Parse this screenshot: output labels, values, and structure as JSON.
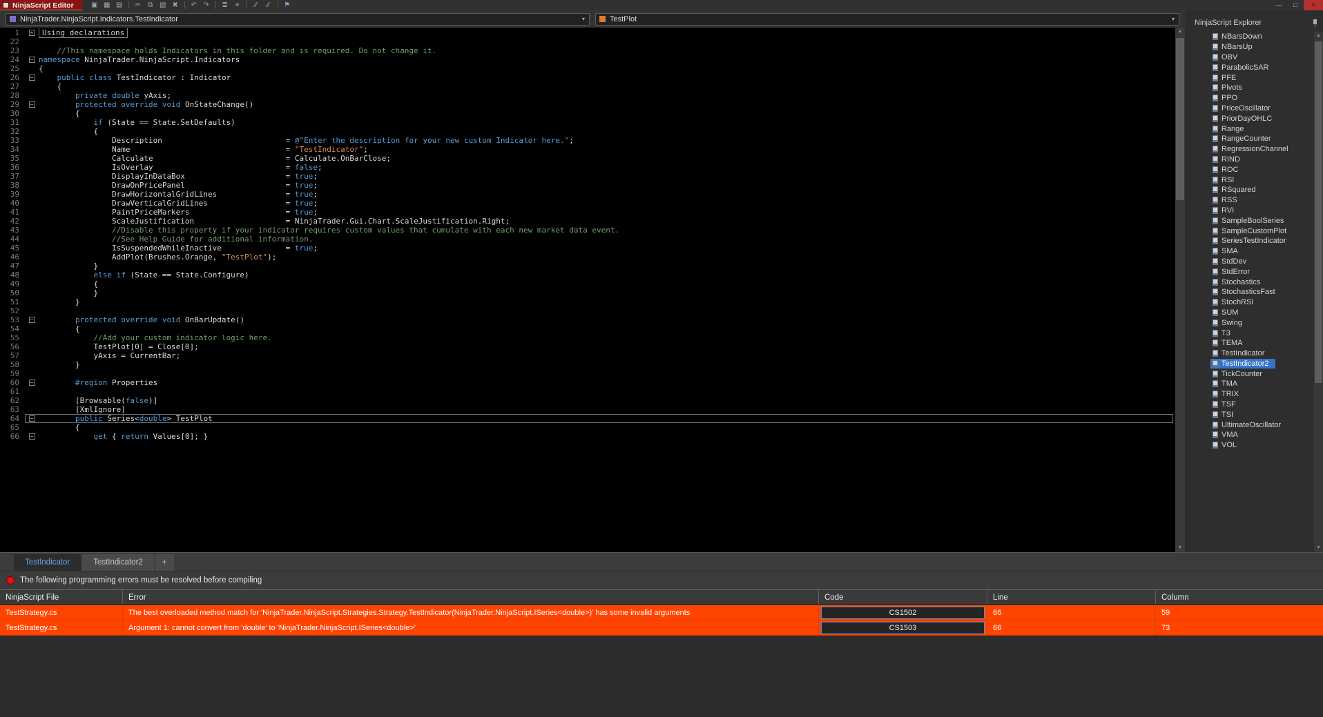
{
  "window": {
    "title": "NinjaScript Editor",
    "controls": {
      "minimize": "—",
      "maximize": "□",
      "close": "×"
    }
  },
  "toolbar": {
    "icons": [
      {
        "name": "save-icon",
        "glyph": "▣"
      },
      {
        "name": "save-all-icon",
        "glyph": "▦"
      },
      {
        "name": "print-icon",
        "glyph": "▤"
      },
      {
        "name": "separator"
      },
      {
        "name": "cut-icon",
        "glyph": "✂"
      },
      {
        "name": "copy-icon",
        "glyph": "⧉"
      },
      {
        "name": "paste-icon",
        "glyph": "▧"
      },
      {
        "name": "delete-icon",
        "glyph": "✖"
      },
      {
        "name": "separator"
      },
      {
        "name": "undo-icon",
        "glyph": "↶"
      },
      {
        "name": "redo-icon",
        "glyph": "↷"
      },
      {
        "name": "separator"
      },
      {
        "name": "format-document-icon",
        "glyph": "≣"
      },
      {
        "name": "indent-icon",
        "glyph": "≡"
      },
      {
        "name": "separator"
      },
      {
        "name": "comment-selection-icon",
        "glyph": "∕∕"
      },
      {
        "name": "uncomment-selection-icon",
        "glyph": "∕∕"
      },
      {
        "name": "separator"
      },
      {
        "name": "compile-icon",
        "glyph": "⚑",
        "accent": true
      }
    ]
  },
  "combos": {
    "type": {
      "value": "NinjaTrader.NinjaScript.Indicators.TestIndicator"
    },
    "member": {
      "value": "TestPlot"
    }
  },
  "icons": {
    "chevron": "▾",
    "scroll_up": "▲",
    "scroll_down": "▼"
  },
  "editor": {
    "lines": [
      {
        "n": 1,
        "fold": "+",
        "box": "Using declarations"
      },
      {
        "n": 22,
        "seg": []
      },
      {
        "n": 23,
        "seg": [
          [
            "c",
            "    //This namespace holds Indicators in this folder and is required. Do not change it."
          ]
        ]
      },
      {
        "n": 24,
        "fold": "-",
        "seg": [
          [
            "k",
            "namespace"
          ],
          [
            "p",
            " NinjaTrader.NinjaScript.Indicators"
          ]
        ]
      },
      {
        "n": 25,
        "seg": [
          [
            "p",
            "{"
          ]
        ]
      },
      {
        "n": 26,
        "fold": "-",
        "seg": [
          [
            "p",
            "    "
          ],
          [
            "k",
            "public"
          ],
          [
            "p",
            " "
          ],
          [
            "k",
            "class"
          ],
          [
            "p",
            " TestIndicator : Indicator"
          ]
        ]
      },
      {
        "n": 27,
        "seg": [
          [
            "p",
            "    {"
          ]
        ]
      },
      {
        "n": 28,
        "seg": [
          [
            "p",
            "        "
          ],
          [
            "k",
            "private"
          ],
          [
            "p",
            " "
          ],
          [
            "k",
            "double"
          ],
          [
            "p",
            " yAxis;"
          ]
        ]
      },
      {
        "n": 29,
        "fold": "-",
        "seg": [
          [
            "p",
            "        "
          ],
          [
            "k",
            "protected"
          ],
          [
            "p",
            " "
          ],
          [
            "k",
            "override"
          ],
          [
            "p",
            " "
          ],
          [
            "k",
            "void"
          ],
          [
            "p",
            " OnStateChange()"
          ]
        ]
      },
      {
        "n": 30,
        "seg": [
          [
            "p",
            "        {"
          ]
        ]
      },
      {
        "n": 31,
        "seg": [
          [
            "p",
            "            "
          ],
          [
            "k",
            "if"
          ],
          [
            "p",
            " (State == State.SetDefaults)"
          ]
        ]
      },
      {
        "n": 32,
        "seg": [
          [
            "p",
            "            {"
          ]
        ]
      },
      {
        "n": 33,
        "seg": [
          [
            "p",
            "                "
          ],
          [
            "f",
            "Description"
          ],
          [
            "p",
            "= "
          ],
          [
            "v",
            "@\"Enter the description for your new custom Indicator here.\""
          ],
          [
            "p",
            ";"
          ]
        ]
      },
      {
        "n": 34,
        "seg": [
          [
            "p",
            "                "
          ],
          [
            "f",
            "Name"
          ],
          [
            "p",
            "= "
          ],
          [
            "s",
            "\"TestIndicator\""
          ],
          [
            "p",
            ";"
          ]
        ]
      },
      {
        "n": 35,
        "seg": [
          [
            "p",
            "                "
          ],
          [
            "f",
            "Calculate"
          ],
          [
            "p",
            "= Calculate.OnBarClose;"
          ]
        ]
      },
      {
        "n": 36,
        "seg": [
          [
            "p",
            "                "
          ],
          [
            "f",
            "IsOverlay"
          ],
          [
            "p",
            "= "
          ],
          [
            "k",
            "false"
          ],
          [
            "p",
            ";"
          ]
        ]
      },
      {
        "n": 37,
        "seg": [
          [
            "p",
            "                "
          ],
          [
            "f",
            "DisplayInDataBox"
          ],
          [
            "p",
            "= "
          ],
          [
            "k",
            "true"
          ],
          [
            "p",
            ";"
          ]
        ]
      },
      {
        "n": 38,
        "seg": [
          [
            "p",
            "                "
          ],
          [
            "f",
            "DrawOnPricePanel"
          ],
          [
            "p",
            "= "
          ],
          [
            "k",
            "true"
          ],
          [
            "p",
            ";"
          ]
        ]
      },
      {
        "n": 39,
        "seg": [
          [
            "p",
            "                "
          ],
          [
            "f",
            "DrawHorizontalGridLines"
          ],
          [
            "p",
            "= "
          ],
          [
            "k",
            "true"
          ],
          [
            "p",
            ";"
          ]
        ]
      },
      {
        "n": 40,
        "seg": [
          [
            "p",
            "                "
          ],
          [
            "f",
            "DrawVerticalGridLines"
          ],
          [
            "p",
            "= "
          ],
          [
            "k",
            "true"
          ],
          [
            "p",
            ";"
          ]
        ]
      },
      {
        "n": 41,
        "seg": [
          [
            "p",
            "                "
          ],
          [
            "f",
            "PaintPriceMarkers"
          ],
          [
            "p",
            "= "
          ],
          [
            "k",
            "true"
          ],
          [
            "p",
            ";"
          ]
        ]
      },
      {
        "n": 42,
        "seg": [
          [
            "p",
            "                "
          ],
          [
            "f",
            "ScaleJustification"
          ],
          [
            "p",
            "= NinjaTrader.Gui.Chart.ScaleJustification.Right;"
          ]
        ]
      },
      {
        "n": 43,
        "seg": [
          [
            "c",
            "                //Disable this property if your indicator requires custom values that cumulate with each new market data event."
          ]
        ]
      },
      {
        "n": 44,
        "seg": [
          [
            "c",
            "                //See Help Guide for additional information."
          ]
        ]
      },
      {
        "n": 45,
        "seg": [
          [
            "p",
            "                "
          ],
          [
            "f",
            "IsSuspendedWhileInactive"
          ],
          [
            "p",
            "= "
          ],
          [
            "k",
            "true"
          ],
          [
            "p",
            ";"
          ]
        ]
      },
      {
        "n": 46,
        "seg": [
          [
            "p",
            "                AddPlot(Brushes.Orange, "
          ],
          [
            "s",
            "\"TestPlot\""
          ],
          [
            "p",
            ");"
          ]
        ]
      },
      {
        "n": 47,
        "seg": [
          [
            "p",
            "            }"
          ]
        ]
      },
      {
        "n": 48,
        "seg": [
          [
            "p",
            "            "
          ],
          [
            "k",
            "else"
          ],
          [
            "p",
            " "
          ],
          [
            "k",
            "if"
          ],
          [
            "p",
            " (State == State.Configure)"
          ]
        ]
      },
      {
        "n": 49,
        "seg": [
          [
            "p",
            "            {"
          ]
        ]
      },
      {
        "n": 50,
        "seg": [
          [
            "p",
            "            }"
          ]
        ]
      },
      {
        "n": 51,
        "seg": [
          [
            "p",
            "        }"
          ]
        ]
      },
      {
        "n": 52,
        "seg": []
      },
      {
        "n": 53,
        "fold": "-",
        "seg": [
          [
            "p",
            "        "
          ],
          [
            "k",
            "protected"
          ],
          [
            "p",
            " "
          ],
          [
            "k",
            "override"
          ],
          [
            "p",
            " "
          ],
          [
            "k",
            "void"
          ],
          [
            "p",
            " OnBarUpdate()"
          ]
        ]
      },
      {
        "n": 54,
        "seg": [
          [
            "p",
            "        {"
          ]
        ]
      },
      {
        "n": 55,
        "seg": [
          [
            "c",
            "            //Add your custom indicator logic here."
          ]
        ]
      },
      {
        "n": 56,
        "seg": [
          [
            "p",
            "            TestPlot[0] = Close[0];"
          ]
        ]
      },
      {
        "n": 57,
        "seg": [
          [
            "p",
            "            yAxis = CurrentBar;"
          ]
        ]
      },
      {
        "n": 58,
        "seg": [
          [
            "p",
            "        }"
          ]
        ]
      },
      {
        "n": 59,
        "seg": []
      },
      {
        "n": 60,
        "fold": "-",
        "seg": [
          [
            "p",
            "        "
          ],
          [
            "k",
            "#region"
          ],
          [
            "p",
            " Properties"
          ]
        ]
      },
      {
        "n": 61,
        "seg": []
      },
      {
        "n": 62,
        "seg": [
          [
            "p",
            "        [Browsable("
          ],
          [
            "k",
            "false"
          ],
          [
            "p",
            ")]"
          ]
        ]
      },
      {
        "n": 63,
        "seg": [
          [
            "p",
            "        [XmlIgnore]"
          ]
        ]
      },
      {
        "n": 64,
        "fold": "-",
        "current": true,
        "seg": [
          [
            "p",
            "        "
          ],
          [
            "k",
            "public"
          ],
          [
            "p",
            " Series<"
          ],
          [
            "k",
            "double"
          ],
          [
            "p",
            "> TestPlot"
          ]
        ]
      },
      {
        "n": 65,
        "seg": [
          [
            "p",
            "        {"
          ]
        ]
      },
      {
        "n": 66,
        "fold": "-",
        "seg": [
          [
            "p",
            "            "
          ],
          [
            "k",
            "get"
          ],
          [
            "p",
            " { "
          ],
          [
            "k",
            "return"
          ],
          [
            "p",
            " Values[0]; }"
          ]
        ]
      }
    ]
  },
  "explorer": {
    "title": "NinjaScript Explorer",
    "selected": "TestIndicator2",
    "items": [
      "NBarsDown",
      "NBarsUp",
      "OBV",
      "ParabolicSAR",
      "PFE",
      "Pivots",
      "PPO",
      "PriceOscillator",
      "PriorDayOHLC",
      "Range",
      "RangeCounter",
      "RegressionChannel",
      "RIND",
      "ROC",
      "RSI",
      "RSquared",
      "RSS",
      "RVI",
      "SampleBoolSeries",
      "SampleCustomPlot",
      "SeriesTestIndicator",
      "SMA",
      "StdDev",
      "StdError",
      "Stochastics",
      "StochasticsFast",
      "StochRSI",
      "SUM",
      "Swing",
      "T3",
      "TEMA",
      "TestIndicator",
      "TestIndicator2",
      "TickCounter",
      "TMA",
      "TRIX",
      "TSF",
      "TSI",
      "UltimateOscillator",
      "VMA",
      "VOL"
    ]
  },
  "tabs": {
    "new_tab_label": "+",
    "items": [
      {
        "label": "TestIndicator",
        "active": true
      },
      {
        "label": "TestIndicator2",
        "active": false
      }
    ]
  },
  "errors": {
    "banner": "The following programming errors must be resolved before compiling",
    "headers": [
      "NinjaScript File",
      "Error",
      "Code",
      "Line",
      "Column"
    ],
    "rows": [
      {
        "file": "TestStrategy.cs",
        "error": "The best overloaded method match for 'NinjaTrader.NinjaScript.Strategies.Strategy.TestIndicator(NinjaTrader.NinjaScript.ISeries<double>)' has some invalid arguments",
        "code": "CS1502",
        "line": "66",
        "column": "59"
      },
      {
        "file": "TestStrategy.cs",
        "error": "Argument 1: cannot convert from 'double' to 'NinjaTrader.NinjaScript.ISeries<double>'",
        "code": "CS1503",
        "line": "66",
        "column": "73"
      }
    ]
  },
  "colors": {
    "title_bar": "#8a1414",
    "selection": "#3673c8",
    "error_row": "#ff4400",
    "keyword": "#569cd6",
    "string": "#d98c5f",
    "verbatim_string": "#569cd6",
    "comment": "#6f9e6a",
    "plot_accent": "#e0772c"
  }
}
